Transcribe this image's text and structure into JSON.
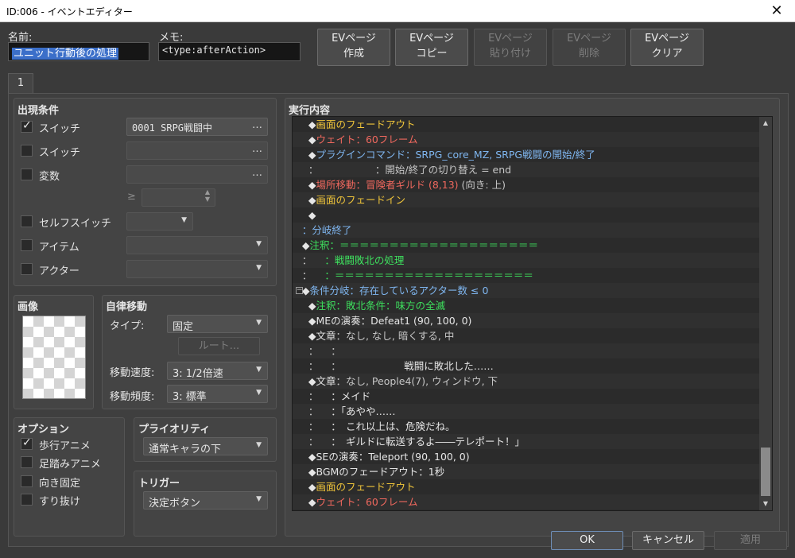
{
  "window": {
    "title": "ID:006 - イベントエディター",
    "close_glyph": "✕"
  },
  "name_label": "名前:",
  "name_value": "ユニット行動後の処理",
  "memo_label": "メモ:",
  "memo_value": "<type:afterAction>",
  "page_buttons": {
    "create": [
      "EVページ",
      "作成"
    ],
    "copy": [
      "EVページ",
      "コピー"
    ],
    "paste": [
      "EVページ",
      "貼り付け"
    ],
    "delete": [
      "EVページ",
      "削除"
    ],
    "clear": [
      "EVページ",
      "クリア"
    ]
  },
  "tab_label": "1",
  "conditions": {
    "title": "出現条件",
    "switch1": {
      "label": "スイッチ",
      "value": "0001 SRPG戦闘中",
      "checked": true
    },
    "switch2": {
      "label": "スイッチ",
      "value": "",
      "checked": false
    },
    "variable": {
      "label": "変数",
      "value": "",
      "checked": false
    },
    "ge_symbol": "≥",
    "self_switch": {
      "label": "セルフスイッチ",
      "checked": false
    },
    "item": {
      "label": "アイテム",
      "checked": false
    },
    "actor": {
      "label": "アクター",
      "checked": false
    },
    "dots": "…"
  },
  "image": {
    "title": "画像"
  },
  "autonomous": {
    "title": "自律移動",
    "type_label": "タイプ:",
    "type_value": "固定",
    "route_button": "ルート...",
    "speed_label": "移動速度:",
    "speed_value": "3: 1/2倍速",
    "freq_label": "移動頻度:",
    "freq_value": "3: 標準"
  },
  "options": {
    "title": "オプション",
    "walking": {
      "label": "歩行アニメ",
      "checked": true
    },
    "stepping": {
      "label": "足踏みアニメ",
      "checked": false
    },
    "direction_fix": {
      "label": "向き固定",
      "checked": false
    },
    "through": {
      "label": "すり抜け",
      "checked": false
    }
  },
  "priority": {
    "title": "プライオリティ",
    "value": "通常キャラの下"
  },
  "trigger": {
    "title": "トリガー",
    "value": "決定ボタン"
  },
  "contents": {
    "title": "実行内容",
    "rows": [
      [
        {
          "t": "     ◆",
          "c": "w"
        },
        {
          "t": "画面のフェードアウト",
          "c": "y"
        }
      ],
      [
        {
          "t": "     ◆",
          "c": "w"
        },
        {
          "t": "ウェイト：60フレーム",
          "c": "r"
        }
      ],
      [
        {
          "t": "     ◆",
          "c": "w"
        },
        {
          "t": "プラグインコマンド：SRPG_core_MZ, SRPG戦闘の開始/終了",
          "c": "b"
        }
      ],
      [
        {
          "t": "     ：                  ：開始/終了の切り替え = end",
          "c": "d"
        }
      ],
      [
        {
          "t": "     ◆",
          "c": "w"
        },
        {
          "t": "場所移動：冒険者ギルド (8,13)",
          "c": "r"
        },
        {
          "t": " (向き: 上)",
          "c": "d"
        }
      ],
      [
        {
          "t": "     ◆",
          "c": "w"
        },
        {
          "t": "画面のフェードイン",
          "c": "y"
        }
      ],
      [
        {
          "t": "     ◆",
          "c": "w"
        }
      ],
      [
        {
          "t": "   ：分岐終了",
          "c": "b"
        }
      ],
      [
        {
          "t": "   ◆",
          "c": "w"
        },
        {
          "t": "注釈：＝＝＝＝＝＝＝＝＝＝＝＝＝＝＝＝＝＝＝＝",
          "c": "g"
        }
      ],
      [
        {
          "t": "   ：    ",
          "c": "d"
        },
        {
          "t": "：戦闘敗北の処理",
          "c": "g"
        }
      ],
      [
        {
          "t": "   ：    ",
          "c": "d"
        },
        {
          "t": "：＝＝＝＝＝＝＝＝＝＝＝＝＝＝＝＝＝＝＝＝",
          "c": "g"
        }
      ],
      [
        {
          "t": "   ◆",
          "c": "w"
        },
        {
          "t": "条件分岐：存在しているアクター数 ≤ 0",
          "c": "b"
        }
      ],
      [
        {
          "t": "     ◆",
          "c": "w"
        },
        {
          "t": "注釈：敗北条件：味方の全滅",
          "c": "g"
        }
      ],
      [
        {
          "t": "     ◆MEの演奏：Defeat1 (90, 100, 0)",
          "c": "w"
        }
      ],
      [
        {
          "t": "     ◆文章",
          "c": "w"
        },
        {
          "t": "：なし, なし, 暗くする, 中",
          "c": "d"
        }
      ],
      [
        {
          "t": "     ：    ：",
          "c": "d"
        }
      ],
      [
        {
          "t": "     ：    ：                    ",
          "c": "d"
        },
        {
          "t": "戦闘に敗北した……",
          "c": "w"
        }
      ],
      [
        {
          "t": "     ◆文章",
          "c": "w"
        },
        {
          "t": "：なし, People4(7), ウィンドウ, 下",
          "c": "d"
        }
      ],
      [
        {
          "t": "     ：    ",
          "c": "d"
        },
        {
          "t": "：メイド",
          "c": "w"
        }
      ],
      [
        {
          "t": "     ：    ",
          "c": "d"
        },
        {
          "t": "：「あやや……",
          "c": "w"
        }
      ],
      [
        {
          "t": "     ：    ",
          "c": "d"
        },
        {
          "t": "：　これ以上は、危険だね。",
          "c": "w"
        }
      ],
      [
        {
          "t": "     ：    ",
          "c": "d"
        },
        {
          "t": "：　ギルドに転送するよ――テレポート！」",
          "c": "w"
        }
      ],
      [
        {
          "t": "     ◆SEの演奏：Teleport (90, 100, 0)",
          "c": "w"
        }
      ],
      [
        {
          "t": "     ◆BGMのフェードアウト：1秒",
          "c": "w"
        }
      ],
      [
        {
          "t": "     ◆",
          "c": "w"
        },
        {
          "t": "画面のフェードアウト",
          "c": "y"
        }
      ],
      [
        {
          "t": "     ◆",
          "c": "w"
        },
        {
          "t": "ウェイト：60フレーム",
          "c": "r"
        }
      ]
    ]
  },
  "footer": {
    "ok": "OK",
    "cancel": "キャンセル",
    "apply": "適用"
  }
}
